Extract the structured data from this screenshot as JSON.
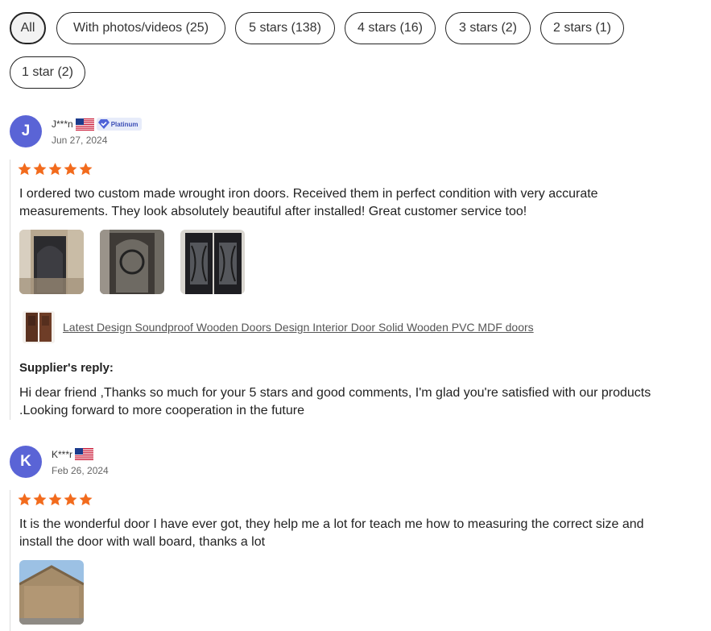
{
  "filters": [
    {
      "label": "All",
      "active": true
    },
    {
      "label": "With photos/videos (25)"
    },
    {
      "label": "5 stars (138)"
    },
    {
      "label": "4 stars (16)"
    },
    {
      "label": "3 stars (2)"
    },
    {
      "label": "2 stars (1)"
    },
    {
      "label": "1 star (2)"
    }
  ],
  "reviews": [
    {
      "initial": "J",
      "user": "J***n",
      "country_flag": "us-flag",
      "badge": "Platinum",
      "date": "Jun 27, 2024",
      "rating": 5,
      "text": "I ordered two custom made wrought iron doors. Received them in perfect condition with very accurate measurements. They look absolutely beautiful after installed! Great customer service too!",
      "photo_count": 3,
      "product_link": "Latest Design Soundproof Wooden Doors Design Interior Door Solid Wooden PVC MDF doors",
      "reply_title": "Supplier's reply:",
      "reply_text": "Hi dear friend ,Thanks so much for your 5 stars and good comments, I'm glad you're satisfied with our products .Looking forward to more cooperation in the future"
    },
    {
      "initial": "K",
      "user": "K***r",
      "country_flag": "us-flag",
      "date": "Feb 26, 2024",
      "rating": 5,
      "text": "It is the wonderful door I have ever got, they help me a lot for teach me how to measuring the correct size and install the door with wall board, thanks a lot",
      "photo_count": 1
    }
  ],
  "colors": {
    "star": "#f26b1d",
    "avatar": "#5a64d6",
    "badge_text": "#3c4fb6"
  }
}
